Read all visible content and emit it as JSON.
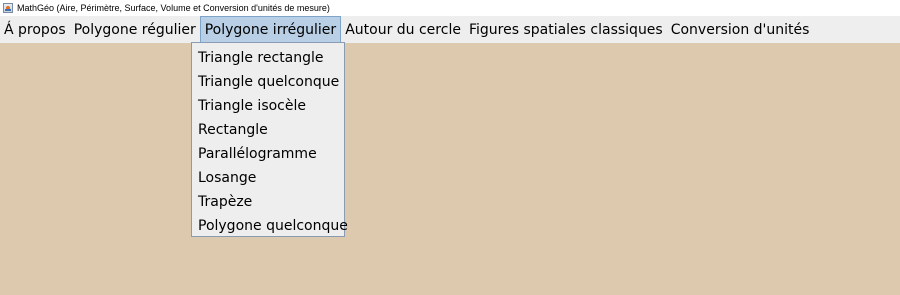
{
  "window": {
    "title": "MathGéo (Aire, Périmètre, Surface, Volume et Conversion d'unités de mesure)",
    "icon": "java-app-icon"
  },
  "colors": {
    "background": "#DDC9AE",
    "menubar": "#EEEEEE",
    "active_menu": "#B8CFE5"
  },
  "menubar": {
    "items": [
      {
        "label": "Á propos"
      },
      {
        "label": "Polygone régulier"
      },
      {
        "label": "Polygone irrégulier",
        "active": true
      },
      {
        "label": "Autour du cercle"
      },
      {
        "label": "Figures spatiales classiques"
      },
      {
        "label": "Conversion d'unités"
      }
    ]
  },
  "dropdown": {
    "items": [
      {
        "label": "Triangle rectangle"
      },
      {
        "label": "Triangle quelconque"
      },
      {
        "label": "Triangle isocèle"
      },
      {
        "label": "Rectangle"
      },
      {
        "label": "Parallélogramme"
      },
      {
        "label": "Losange"
      },
      {
        "label": "Trapèze"
      },
      {
        "label": "Polygone quelconque"
      }
    ]
  }
}
